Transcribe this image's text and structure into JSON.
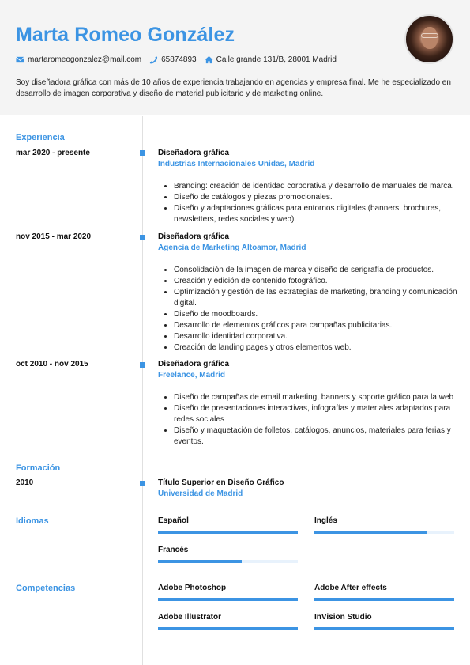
{
  "header": {
    "name": "Marta Romeo González",
    "email": "martaromeogonzalez@mail.com",
    "phone": "65874893",
    "address": "Calle grande 131/B, 28001 Madrid",
    "summary": "Soy diseñadora gráfica con más de 10 años de experiencia trabajando en agencias y empresa final. Me he especializado en desarrollo de imagen corporativa y diseño de material publicitario y de marketing online.",
    "icons": {
      "email": "envelope-icon",
      "phone": "phone-icon",
      "address": "home-icon"
    }
  },
  "colors": {
    "accent": "#3c94e3",
    "header_bg": "#f4f4f4",
    "bar_track": "#e8f2fc"
  },
  "experience": {
    "title": "Experiencia",
    "items": [
      {
        "date": "mar 2020 - presente",
        "role": "Diseñadora gráfica",
        "org": "Industrias Internacionales Unidas, Madrid",
        "bullets": [
          "Branding: creación de identidad corporativa y desarrollo de manuales de marca.",
          "Diseño de catálogos y piezas promocionales.",
          "Diseño y adaptaciones gráficas para entornos digitales (banners, brochures, newsletters, redes sociales y web)."
        ]
      },
      {
        "date": "nov 2015 - mar 2020",
        "role": "Diseñadora gráfica",
        "org": "Agencia de Marketing Altoamor, Madrid",
        "bullets": [
          "Consolidación de la imagen de marca y diseño de serigrafía de productos.",
          "Creación y edición de contenido fotográfico.",
          "Optimización y gestión de las estrategias de marketing, branding y comunicación digital.",
          "Diseño de moodboards.",
          "Desarrollo de elementos gráficos para campañas publicitarias.",
          "Desarrollo identidad corporativa.",
          "Creación de landing pages y otros elementos web."
        ]
      },
      {
        "date": "oct 2010 - nov 2015",
        "role": "Diseñadora gráfica",
        "org": "Freelance, Madrid",
        "bullets": [
          "Diseño de campañas de email marketing, banners y soporte gráfico para la web",
          "Diseño de presentaciones interactivas, infografías y materiales adaptados para redes sociales",
          "Diseño y maquetación de folletos, catálogos, anuncios, materiales para ferias y eventos."
        ]
      }
    ]
  },
  "education": {
    "title": "Formación",
    "items": [
      {
        "date": "2010",
        "role": "Título Superior en Diseño Gráfico",
        "org": "Universidad de Madrid"
      }
    ]
  },
  "languages": {
    "title": "Idiomas",
    "items": [
      {
        "label": "Español",
        "level_percent": 100
      },
      {
        "label": "Inglés",
        "level_percent": 80
      },
      {
        "label": "Francés",
        "level_percent": 60
      }
    ]
  },
  "skills": {
    "title": "Competencias",
    "items": [
      {
        "label": "Adobe Photoshop",
        "level_percent": 100
      },
      {
        "label": "Adobe After effects",
        "level_percent": 100
      },
      {
        "label": "Adobe Illustrator",
        "level_percent": 100
      },
      {
        "label": "InVision Studio",
        "level_percent": 100
      }
    ]
  }
}
